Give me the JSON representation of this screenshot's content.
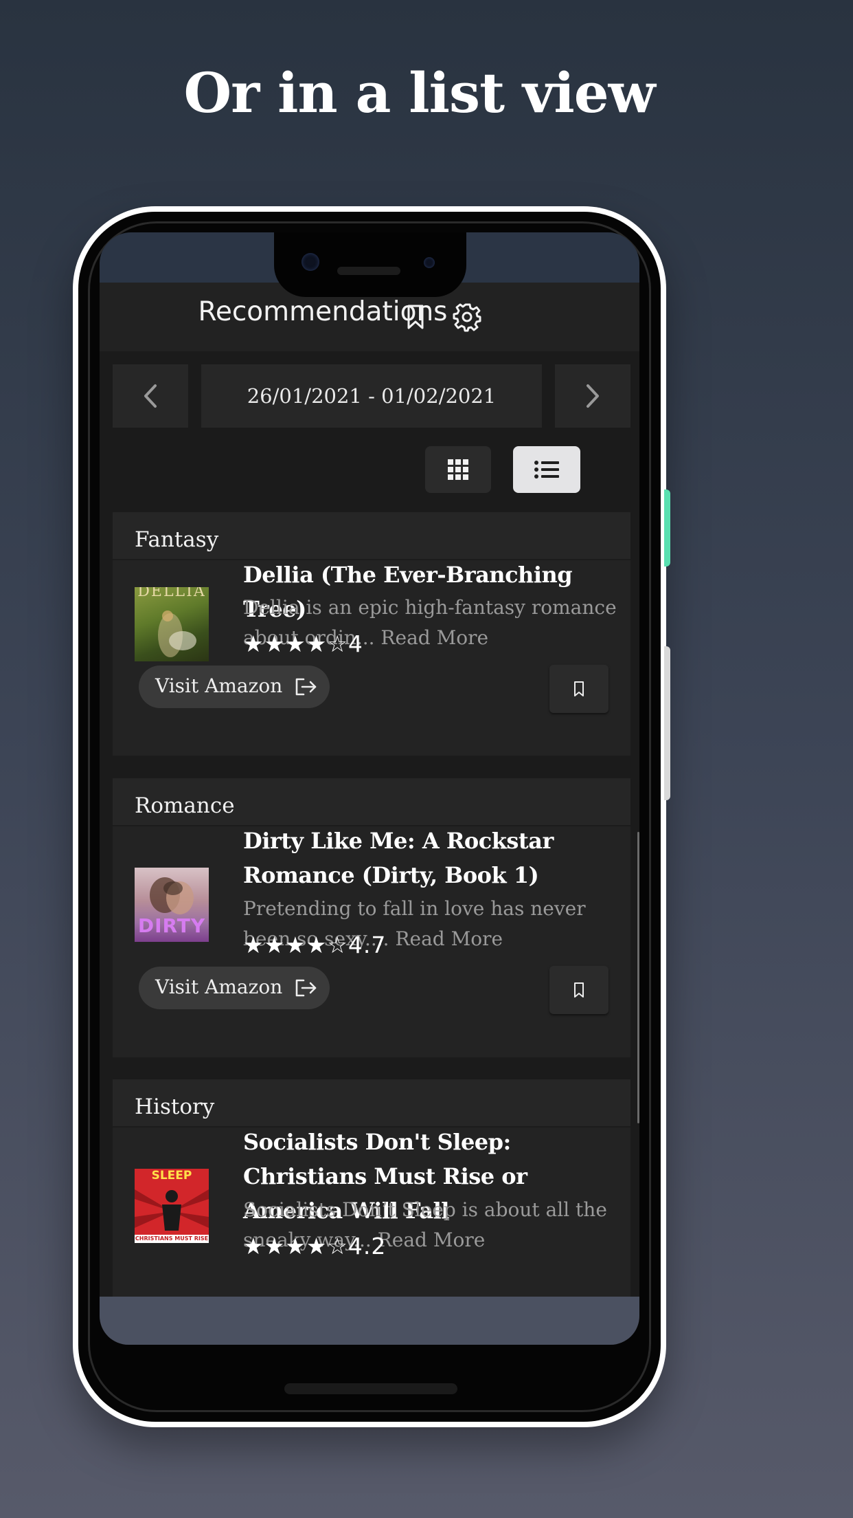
{
  "headline": "Or in a list view",
  "app": {
    "title": "Recommendations",
    "bookmark_icon": "bookmark-icon",
    "settings_icon": "gear-icon"
  },
  "date_nav": {
    "range": "26/01/2021 - 01/02/2021",
    "prev_icon": "chevron-left-icon",
    "next_icon": "chevron-right-icon"
  },
  "view_toggle": {
    "grid_icon": "grid-icon",
    "list_icon": "list-icon",
    "active": "list"
  },
  "colors": {
    "background_top": "#293340",
    "background_bottom": "#575a6a",
    "surface": "#232323",
    "accent_active_toggle": "#e4e4e6",
    "side_button": "#59e0b0"
  },
  "cards": [
    {
      "genre": "Fantasy",
      "title": "Dellia (The Ever-Branching Tree)",
      "description": "Dellia is an epic high-fantasy romance about ordin... Read More",
      "stars": "★★★★☆",
      "rating": "4",
      "cover_text": "DELLIA",
      "visit_label": "Visit Amazon"
    },
    {
      "genre": "Romance",
      "title": "Dirty Like Me: A Rockstar Romance (Dirty, Book 1)",
      "description": "Pretending to fall in love has never been so sexy.... Read More",
      "stars": "★★★★☆",
      "rating": "4.7",
      "cover_text": "DIRTY",
      "visit_label": "Visit Amazon"
    },
    {
      "genre": "History",
      "title": "Socialists Don't Sleep: Christians Must Rise or America Will Fall",
      "description": "Socialists Don’t Sleep is about all the sneaky way... Read More",
      "stars": "★★★★☆",
      "rating": "4.2",
      "cover_text": "SLEEP",
      "cover_subtext": "CHRISTIANS MUST RISE"
    }
  ]
}
